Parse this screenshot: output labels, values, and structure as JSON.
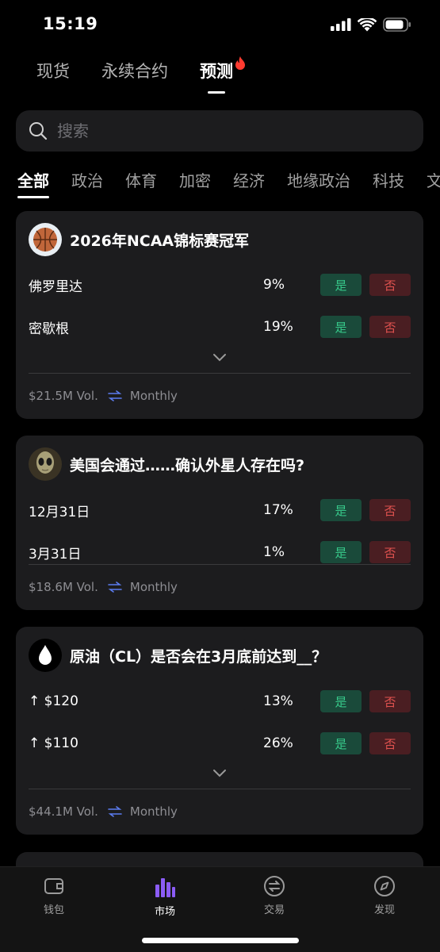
{
  "status_bar": {
    "time": "15:19"
  },
  "top_tabs": [
    {
      "label": "现货"
    },
    {
      "label": "永续合约"
    },
    {
      "label": "预测",
      "active": true
    }
  ],
  "search": {
    "placeholder": "搜索"
  },
  "categories": [
    {
      "label": "全部",
      "active": true
    },
    {
      "label": "政治"
    },
    {
      "label": "体育"
    },
    {
      "label": "加密"
    },
    {
      "label": "经济"
    },
    {
      "label": "地缘政治"
    },
    {
      "label": "科技"
    },
    {
      "label": "文"
    }
  ],
  "markets": [
    {
      "title": "2026年NCAA锦标赛冠军",
      "icon": "basketball-icon",
      "outcomes": [
        {
          "label": "佛罗里达",
          "pct": "9%",
          "yes": "是",
          "no": "否"
        },
        {
          "label": "密歇根",
          "pct": "19%",
          "yes": "是",
          "no": "否"
        }
      ],
      "volume": "$21.5M Vol.",
      "frequency": "Monthly"
    },
    {
      "title": "美国会通过……确认外星人存在吗?",
      "icon": "alien-icon",
      "outcomes": [
        {
          "label": "12月31日",
          "pct": "17%",
          "yes": "是",
          "no": "否"
        },
        {
          "label": "3月31日",
          "pct": "1%",
          "yes": "是",
          "no": "否"
        }
      ],
      "volume": "$18.6M Vol.",
      "frequency": "Monthly"
    },
    {
      "title": "原油（CL）是否会在3月底前达到__？",
      "icon": "oil-drop-icon",
      "outcomes": [
        {
          "label": "↑ $120",
          "pct": "13%",
          "yes": "是",
          "no": "否"
        },
        {
          "label": "↑ $110",
          "pct": "26%",
          "yes": "是",
          "no": "否"
        }
      ],
      "volume": "$44.1M Vol.",
      "frequency": "Monthly"
    }
  ],
  "bottom_nav": [
    {
      "label": "钱包",
      "icon": "wallet-icon"
    },
    {
      "label": "市场",
      "icon": "market-chart-icon",
      "active": true
    },
    {
      "label": "交易",
      "icon": "trade-swap-icon"
    },
    {
      "label": "发现",
      "icon": "compass-icon"
    }
  ],
  "colors": {
    "background": "#000000",
    "card": "#1c1c1e",
    "yes_bg": "#1a4a3a",
    "yes_text": "#37c98a",
    "no_bg": "#4a1e22",
    "no_text": "#e0524f",
    "accent_purple": "#8b5cf6",
    "flame": "#ff3b30"
  }
}
